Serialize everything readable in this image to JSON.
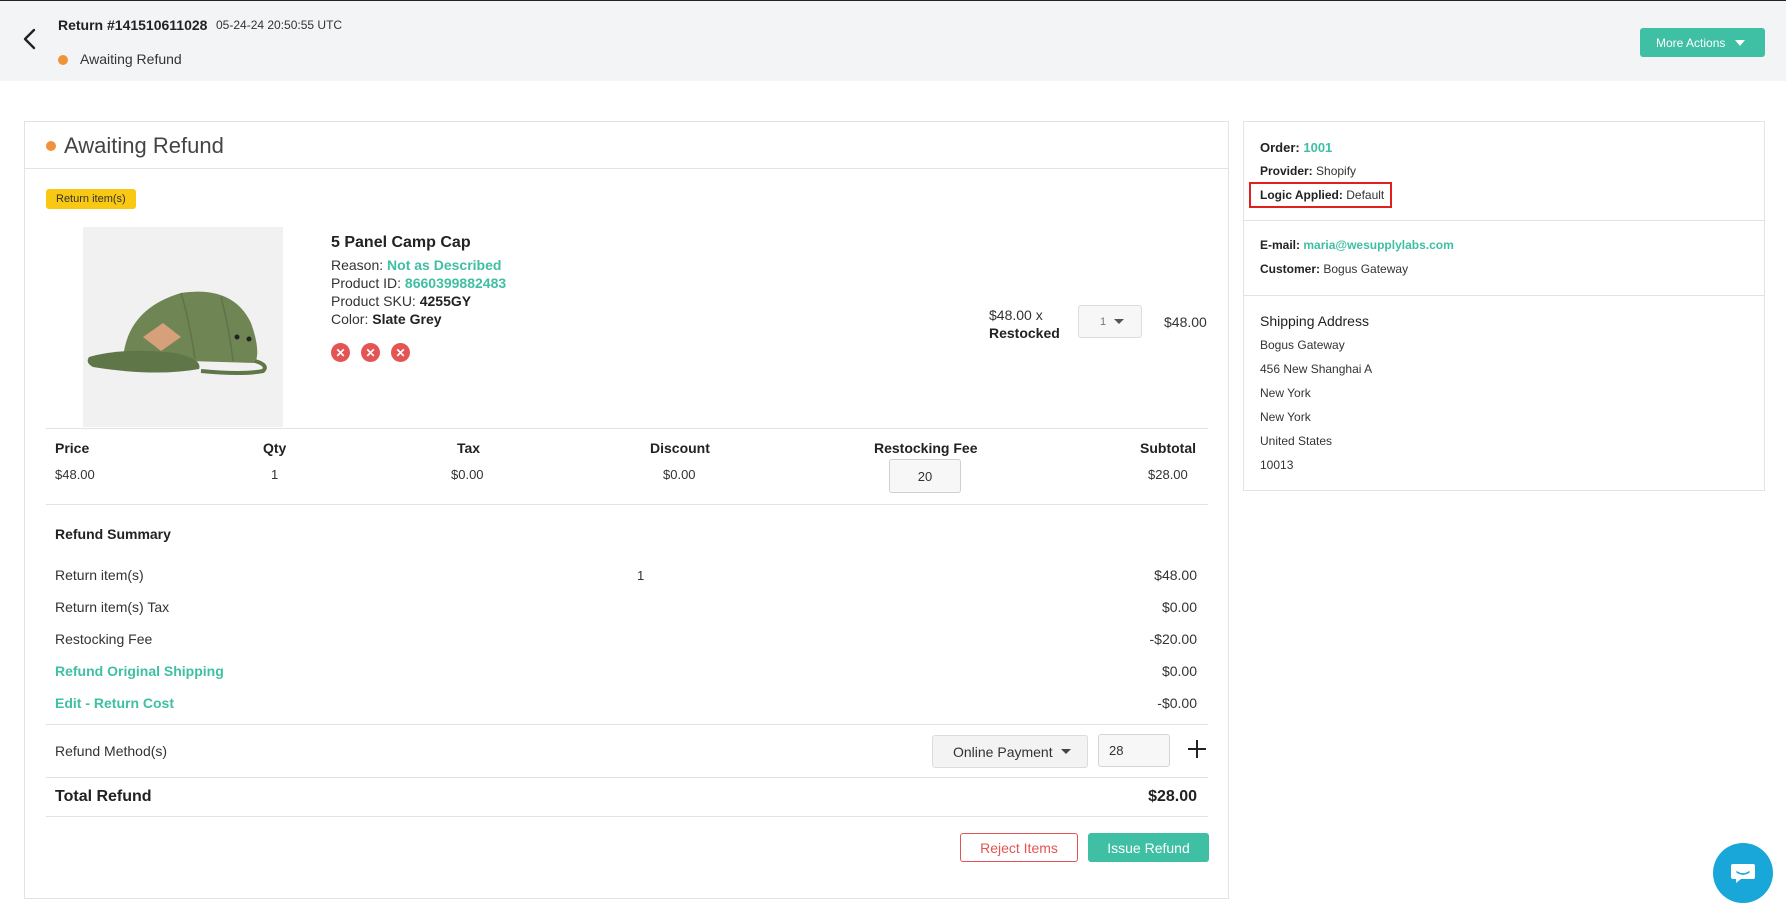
{
  "header": {
    "return_title": "Return #141510611028",
    "return_date": "05-24-24 20:50:55 UTC",
    "status": "Awaiting Refund",
    "more_actions_label": "More Actions"
  },
  "main": {
    "card_title": "Awaiting Refund",
    "badge": "Return item(s)",
    "product": {
      "name": "5 Panel Camp Cap",
      "reason_label": "Reason:",
      "reason_value": "Not as Described",
      "product_id_label": "Product ID:",
      "product_id_value": "8660399882483",
      "sku_label": "Product SKU:",
      "sku_value": "4255GY",
      "color_label": "Color:",
      "color_value": "Slate Grey",
      "unit_price": "$48.00 x",
      "restocked_label": "Restocked",
      "qty_selected": "1",
      "line_total": "$48.00"
    },
    "table": {
      "headers": [
        "Price",
        "Qty",
        "Tax",
        "Discount",
        "Restocking Fee",
        "Subtotal"
      ],
      "values": [
        "$48.00",
        "1",
        "$0.00",
        "$0.00",
        "20",
        "$28.00"
      ]
    },
    "summary": {
      "title": "Refund Summary",
      "rows": [
        {
          "label": "Return item(s)",
          "mid": "1",
          "value": "$48.00"
        },
        {
          "label": "Return item(s) Tax",
          "mid": "",
          "value": "$0.00"
        },
        {
          "label": "Restocking Fee",
          "mid": "",
          "value": "-$20.00"
        },
        {
          "label": "Refund Original Shipping",
          "mid": "",
          "value": "$0.00"
        },
        {
          "label": "Edit - Return Cost",
          "mid": "",
          "value": "-$0.00"
        }
      ]
    },
    "refund_method": {
      "label": "Refund Method(s)",
      "selected": "Online Payment",
      "amount": "28"
    },
    "total": {
      "label": "Total Refund",
      "value": "$28.00"
    },
    "buttons": {
      "reject": "Reject Items",
      "issue": "Issue Refund"
    }
  },
  "sidebar": {
    "order_label": "Order:",
    "order_value": "1001",
    "provider_label": "Provider:",
    "provider_value": "Shopify",
    "logic_label": "Logic Applied:",
    "logic_value": "Default",
    "email_label": "E-mail:",
    "email_value": "maria@wesupplylabs.com",
    "customer_label": "Customer:",
    "customer_value": "Bogus Gateway",
    "shipping_title": "Shipping Address",
    "address_lines": [
      "Bogus Gateway",
      "456 New Shanghai A",
      "New York",
      "New York",
      "United States",
      "10013"
    ]
  },
  "colors": {
    "accent": "#3fbfa3",
    "status_dot": "#f0923a",
    "badge": "#f8c813",
    "danger": "#e55454",
    "chat": "#18a7d8"
  }
}
